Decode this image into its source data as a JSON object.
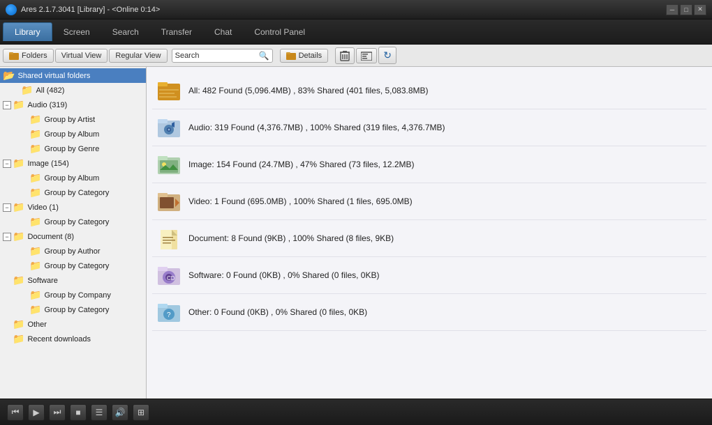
{
  "titlebar": {
    "title": "Ares 2.1.7.3041  [Library]  -  <Online 0:14>",
    "min_label": "─",
    "max_label": "□",
    "close_label": "✕"
  },
  "menubar": {
    "tabs": [
      {
        "id": "library",
        "label": "Library",
        "active": true
      },
      {
        "id": "screen",
        "label": "Screen",
        "active": false
      },
      {
        "id": "search",
        "label": "Search",
        "active": false
      },
      {
        "id": "transfer",
        "label": "Transfer",
        "active": false
      },
      {
        "id": "chat",
        "label": "Chat",
        "active": false
      },
      {
        "id": "control-panel",
        "label": "Control Panel",
        "active": false
      }
    ]
  },
  "toolbar": {
    "folders_label": "Folders",
    "virtual_view_label": "Virtual View",
    "regular_view_label": "Regular View",
    "search_placeholder": "Search",
    "details_label": "Details"
  },
  "sidebar": {
    "items": [
      {
        "id": "shared-virtual",
        "label": "Shared virtual folders",
        "indent": 0,
        "expandable": false,
        "type": "open",
        "selected": true
      },
      {
        "id": "all",
        "label": "All (482)",
        "indent": 1,
        "expandable": false,
        "type": "closed"
      },
      {
        "id": "audio",
        "label": "Audio (319)",
        "indent": 0,
        "expandable": true,
        "expanded": true,
        "type": "closed"
      },
      {
        "id": "audio-artist",
        "label": "Group by Artist",
        "indent": 2,
        "expandable": false,
        "type": "closed"
      },
      {
        "id": "audio-album",
        "label": "Group by Album",
        "indent": 2,
        "expandable": false,
        "type": "closed"
      },
      {
        "id": "audio-genre",
        "label": "Group by Genre",
        "indent": 2,
        "expandable": false,
        "type": "closed"
      },
      {
        "id": "image",
        "label": "Image (154)",
        "indent": 0,
        "expandable": true,
        "expanded": true,
        "type": "closed"
      },
      {
        "id": "image-album",
        "label": "Group by Album",
        "indent": 2,
        "expandable": false,
        "type": "closed"
      },
      {
        "id": "image-category",
        "label": "Group by Category",
        "indent": 2,
        "expandable": false,
        "type": "closed"
      },
      {
        "id": "video",
        "label": "Video (1)",
        "indent": 0,
        "expandable": true,
        "expanded": true,
        "type": "closed"
      },
      {
        "id": "video-category",
        "label": "Group by Category",
        "indent": 2,
        "expandable": false,
        "type": "closed"
      },
      {
        "id": "document",
        "label": "Document (8)",
        "indent": 0,
        "expandable": true,
        "expanded": true,
        "type": "closed"
      },
      {
        "id": "document-author",
        "label": "Group by Author",
        "indent": 2,
        "expandable": false,
        "type": "closed"
      },
      {
        "id": "document-category",
        "label": "Group by Category",
        "indent": 2,
        "expandable": false,
        "type": "closed"
      },
      {
        "id": "software",
        "label": "Software",
        "indent": 0,
        "expandable": false,
        "expanded": true,
        "type": "closed"
      },
      {
        "id": "software-company",
        "label": "Group by Company",
        "indent": 2,
        "expandable": false,
        "type": "closed"
      },
      {
        "id": "software-category",
        "label": "Group by Category",
        "indent": 2,
        "expandable": false,
        "type": "closed"
      },
      {
        "id": "other",
        "label": "Other",
        "indent": 0,
        "expandable": false,
        "type": "closed"
      },
      {
        "id": "recent",
        "label": "Recent downloads",
        "indent": 0,
        "expandable": false,
        "type": "closed"
      }
    ]
  },
  "content": {
    "items": [
      {
        "id": "all",
        "color": "#e8a020",
        "type": "all",
        "text": "All: 482 Found (5,096.4MB) , 83% Shared (401 files, 5,083.8MB)"
      },
      {
        "id": "audio",
        "color": "#6090d0",
        "type": "audio",
        "text": "Audio: 319 Found (4,376.7MB) , 100% Shared (319 files, 4,376.7MB)"
      },
      {
        "id": "image",
        "color": "#60a040",
        "type": "image",
        "text": "Image: 154 Found (24.7MB) , 47% Shared (73 files, 12.2MB)"
      },
      {
        "id": "video",
        "color": "#c06030",
        "type": "video",
        "text": "Video: 1 Found (695.0MB) , 100% Shared (1 files, 695.0MB)"
      },
      {
        "id": "document",
        "color": "#d0b030",
        "type": "document",
        "text": "Document: 8 Found (9KB) , 100% Shared (8 files, 9KB)"
      },
      {
        "id": "software",
        "color": "#8060c0",
        "type": "software",
        "text": "Software: 0 Found (0KB) , 0% Shared (0 files, 0KB)"
      },
      {
        "id": "other",
        "color": "#4090c0",
        "type": "other",
        "text": "Other: 0 Found (0KB) , 0% Shared (0 files, 0KB)"
      }
    ]
  },
  "player": {
    "prev_label": "⏮",
    "play_label": "▶",
    "next_label": "⏭",
    "stop_label": "■",
    "playlist_label": "☰",
    "volume_label": "🔊",
    "eq_label": "⊞"
  }
}
